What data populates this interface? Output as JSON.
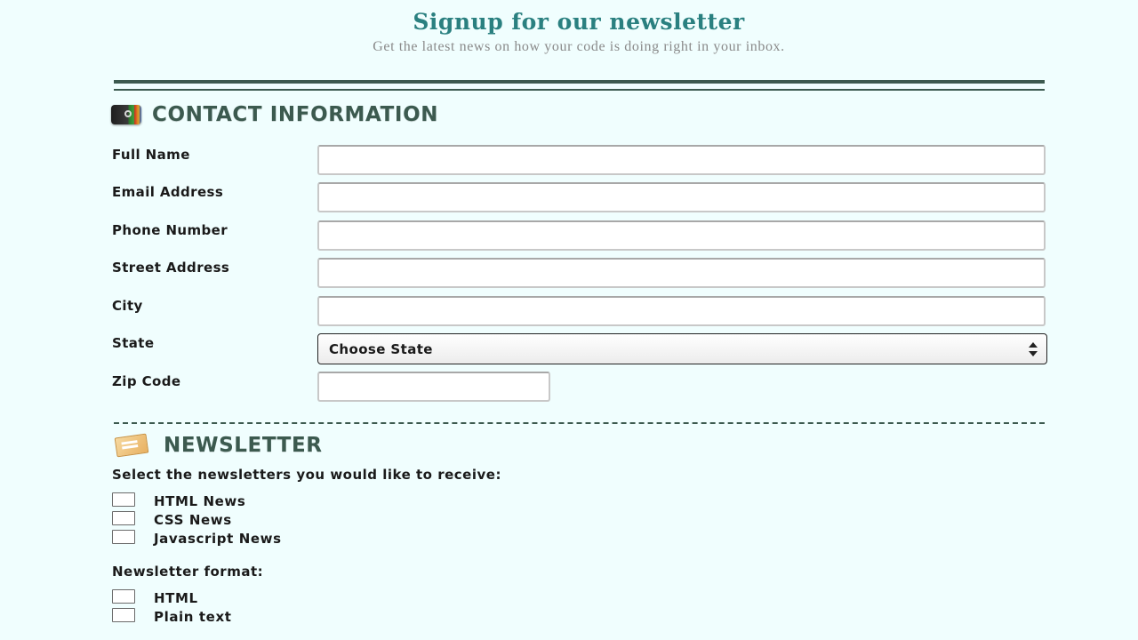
{
  "header": {
    "title": "Signup for our newsletter",
    "subtitle": "Get the latest news on how your code is doing right in your inbox."
  },
  "contact": {
    "section_title": "Contact Information",
    "fields": {
      "full_name": {
        "label": "Full Name",
        "value": ""
      },
      "email": {
        "label": "Email Address",
        "value": ""
      },
      "phone": {
        "label": "Phone Number",
        "value": ""
      },
      "street": {
        "label": "Street Address",
        "value": ""
      },
      "city": {
        "label": "City",
        "value": ""
      },
      "state": {
        "label": "State",
        "selected": "Choose State"
      },
      "zip": {
        "label": "Zip Code",
        "value": ""
      }
    }
  },
  "newsletter": {
    "section_title": "Newsletter",
    "select_prompt": "Select the newsletters you would like to receive:",
    "options": [
      {
        "label": "HTML News",
        "checked": false
      },
      {
        "label": "CSS News",
        "checked": false
      },
      {
        "label": "Javascript News",
        "checked": false
      }
    ],
    "format_prompt": "Newsletter format:",
    "formats": [
      {
        "label": "HTML",
        "checked": false
      },
      {
        "label": "Plain text",
        "checked": false
      }
    ]
  },
  "icons": {
    "contact": "contact-card-icon",
    "newsletter": "newsletter-icon"
  },
  "colors": {
    "background": "#f0fefe",
    "title": "#2a8080",
    "section_heading": "#3c5a4f"
  }
}
